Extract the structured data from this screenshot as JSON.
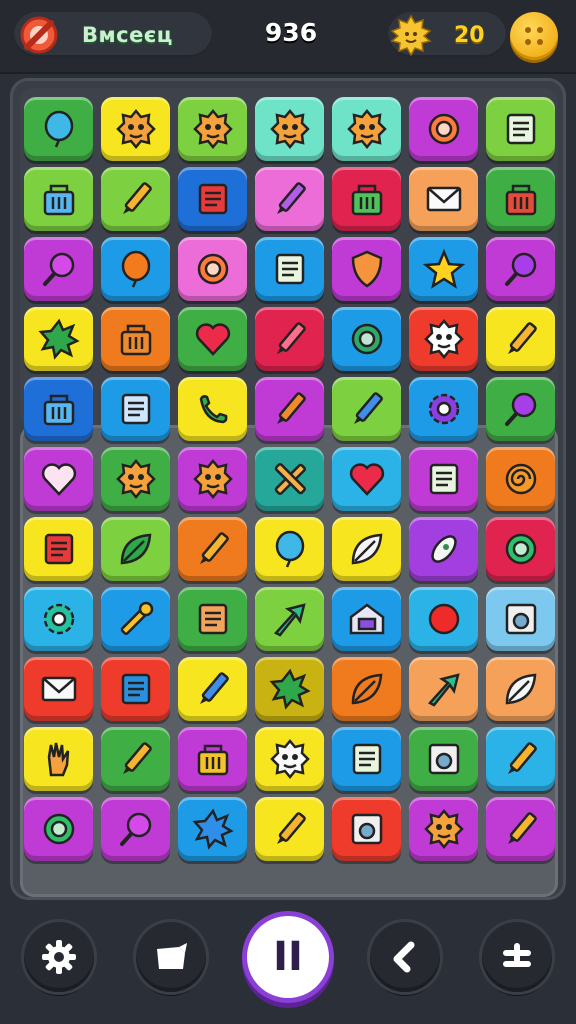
{
  "header": {
    "brand_name": "Bмcеєц",
    "brand_icon": "no-sign-icon",
    "score": "936",
    "coin_icon": "sun-coin-icon",
    "coins": "20",
    "menu_icon": "menu-dots-icon"
  },
  "colors": {
    "green": "#3fae45",
    "yellow": "#f7e61f",
    "lime": "#7dd03f",
    "mint": "#6ee3c8",
    "magenta": "#c03ad6",
    "blue": "#1e9be6",
    "navy": "#1e6fd8",
    "pink": "#ec6cd8",
    "red": "#ee3b2c",
    "orange": "#f07a1e",
    "peach": "#f5a15a",
    "teal": "#25a89a",
    "violet": "#a33ee0",
    "cyan": "#2bb3e8",
    "gold": "#efc21a",
    "crimson": "#e0234f",
    "olive": "#c9b312",
    "sky": "#7cc8ee"
  },
  "board": {
    "rows": [
      [
        "blue-balloon-icon",
        "red-monster-face-icon",
        "orange-monster-face-icon",
        "pink-monster-face-icon",
        "green-monster-face-icon",
        "red-target-square-icon",
        "notepad-icon"
      ],
      [
        "shopping-bag-icon",
        "pencil-icon",
        "red-bar-card-icon",
        "purple-pencil-icon",
        "green-basket-icon",
        "envelope-icon",
        "red-basket-icon"
      ],
      [
        "lollipop-icon",
        "orange-balloon-icon",
        "ring-icon",
        "notepad-icon",
        "shield-icon",
        "star-icon",
        "magnifier-icon"
      ],
      [
        "green-splat-icon",
        "orange-basket-icon",
        "heart-icon",
        "striped-pencil-icon",
        "gear-ring-icon",
        "skull-badge-icon",
        "pencil-icon"
      ],
      [
        "blue-box-icon",
        "s-card-icon",
        "phone-icon",
        "orange-pencil-icon",
        "blue-pencil-icon",
        "purple-gear-icon",
        "magnifier-icon"
      ],
      [
        "heart-outline-icon",
        "orange-monster-face-icon",
        "orange-monster-face-icon",
        "cross-sticks-icon",
        "heart-icon",
        "note-paper-icon",
        "spiral-icon"
      ],
      [
        "red-note-icon",
        "leaf-icon",
        "cross-pencils-icon",
        "blue-balloon-icon",
        "leaf-outline-icon",
        "rocket-icon",
        "green-ring-icon"
      ],
      [
        "gear-icon",
        "wrench-icon",
        "orange-scroll-icon",
        "green-arrow-icon",
        "house-icon",
        "red-ball-icon",
        "washer-icon"
      ],
      [
        "envelope-icon",
        "blue-bar-card-icon",
        "blue-pencil-icon",
        "green-splat-icon",
        "orange-leaf-icon",
        "green-arrow-icon",
        "leaf-outline-icon"
      ],
      [
        "hand-icon",
        "pencil-icon",
        "yellow-basket-icon",
        "ghost-face-icon",
        "notepad-icon",
        "monitor-face-icon",
        "wand-icon"
      ],
      [
        "green-ring-icon",
        "lollipop-icon",
        "blue-splat-icon",
        "leaf-pencil-icon",
        "camera-icon",
        "orange-monster-face-icon",
        "cross-pencils-icon"
      ]
    ],
    "tile_colors": [
      [
        "green",
        "yellow",
        "lime",
        "mint",
        "mint",
        "magenta",
        "lime"
      ],
      [
        "lime",
        "lime",
        "navy",
        "pink",
        "crimson",
        "peach",
        "green"
      ],
      [
        "magenta",
        "blue",
        "pink",
        "blue",
        "magenta",
        "blue",
        "magenta"
      ],
      [
        "yellow",
        "orange",
        "green",
        "crimson",
        "blue",
        "red",
        "yellow"
      ],
      [
        "navy",
        "blue",
        "yellow",
        "magenta",
        "lime",
        "blue",
        "green"
      ],
      [
        "magenta",
        "green",
        "magenta",
        "teal",
        "cyan",
        "magenta",
        "orange"
      ],
      [
        "yellow",
        "lime",
        "orange",
        "yellow",
        "yellow",
        "violet",
        "crimson"
      ],
      [
        "cyan",
        "blue",
        "green",
        "lime",
        "blue",
        "cyan",
        "sky"
      ],
      [
        "red",
        "red",
        "yellow",
        "olive",
        "orange",
        "peach",
        "peach"
      ],
      [
        "yellow",
        "green",
        "magenta",
        "yellow",
        "blue",
        "green",
        "cyan"
      ],
      [
        "magenta",
        "magenta",
        "blue",
        "yellow",
        "red",
        "magenta",
        "magenta"
      ]
    ]
  },
  "controls": [
    {
      "id": "settings",
      "icon": "gear-icon"
    },
    {
      "id": "hint",
      "icon": "bucket-icon"
    },
    {
      "id": "pause",
      "icon": "pause-icon",
      "label": "II"
    },
    {
      "id": "undo",
      "icon": "back-arrow-icon"
    },
    {
      "id": "boosters",
      "icon": "plus-bar-icon"
    }
  ]
}
